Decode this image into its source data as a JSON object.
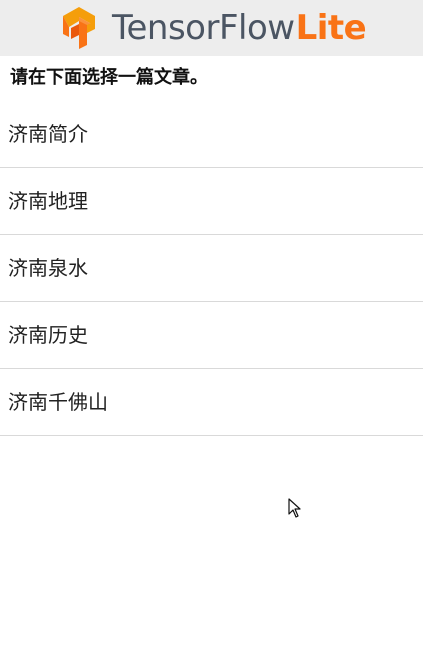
{
  "header": {
    "brand_main": "TensorFlow",
    "brand_accent": "Lite",
    "logo_icon": "tensorflow-logo-icon",
    "background_color": "#ededed",
    "brand_main_color": "#4b5563",
    "brand_accent_color": "#f97316"
  },
  "instruction": {
    "text": "请在下面选择一篇文章。"
  },
  "articles": [
    {
      "label": "济南简介"
    },
    {
      "label": "济南地理"
    },
    {
      "label": "济南泉水"
    },
    {
      "label": "济南历史"
    },
    {
      "label": "济南千佛山"
    }
  ],
  "cursor": {
    "icon": "mouse-pointer-icon"
  }
}
